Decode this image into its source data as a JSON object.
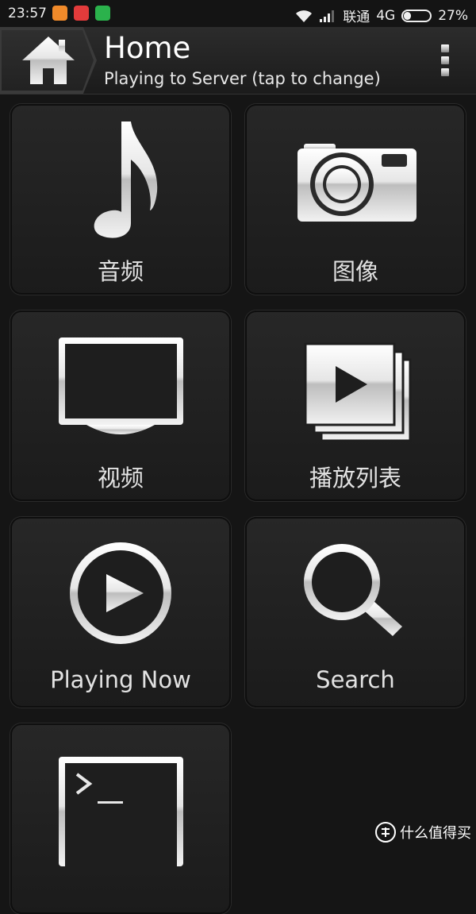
{
  "status_bar": {
    "time": "23:57",
    "carrier": "联通",
    "network": "4G",
    "battery": "27%",
    "battery_level": 0.27,
    "icons": [
      "notification-app-icon",
      "notification-app-icon",
      "notification-app-icon",
      "wifi-icon",
      "signal-icon",
      "battery-icon"
    ],
    "app_icon_colors": [
      "#f08a2a",
      "#e23b3b",
      "#2bb24c"
    ]
  },
  "action_bar": {
    "icon": "home-icon",
    "title": "Home",
    "subtitle": "Playing to Server (tap to change)",
    "menu_icon": "overflow-menu-icon"
  },
  "tiles": [
    {
      "label": "音频",
      "icon": "music-note-icon"
    },
    {
      "label": "图像",
      "icon": "camera-icon"
    },
    {
      "label": "视频",
      "icon": "tv-icon"
    },
    {
      "label": "播放列表",
      "icon": "playlist-icon"
    },
    {
      "label": "Playing Now",
      "icon": "play-circle-icon"
    },
    {
      "label": "Search",
      "icon": "search-icon"
    },
    {
      "label": "",
      "icon": "terminal-icon"
    }
  ],
  "watermark": {
    "text": "什么值得买",
    "icon": "watermark-logo-icon"
  }
}
